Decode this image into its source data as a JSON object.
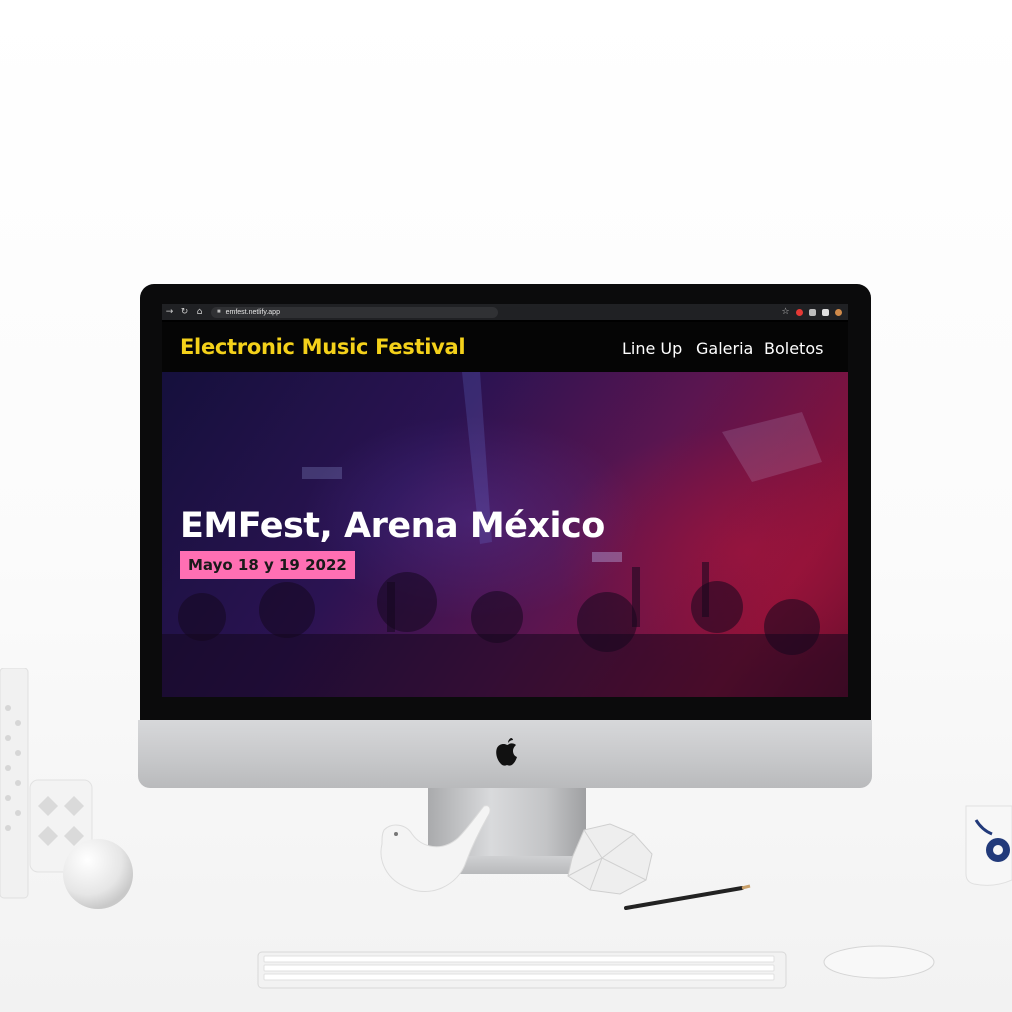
{
  "browser": {
    "url": "emfest.netlify.app",
    "back_icon": "arrow-left-icon",
    "reload_icon": "reload-icon",
    "home_icon": "home-icon",
    "star_icon": "star-icon"
  },
  "site": {
    "title": "Electronic Music Festival",
    "nav": [
      {
        "label": "Line Up"
      },
      {
        "label": "Galeria"
      },
      {
        "label": "Boletos"
      }
    ]
  },
  "hero": {
    "title": "EMFest, Arena México",
    "date": "Mayo 18 y 19 2022"
  },
  "colors": {
    "title_yellow": "#f4d11a",
    "date_badge_pink": "#ff6fb3",
    "nav_bg": "#050505"
  }
}
